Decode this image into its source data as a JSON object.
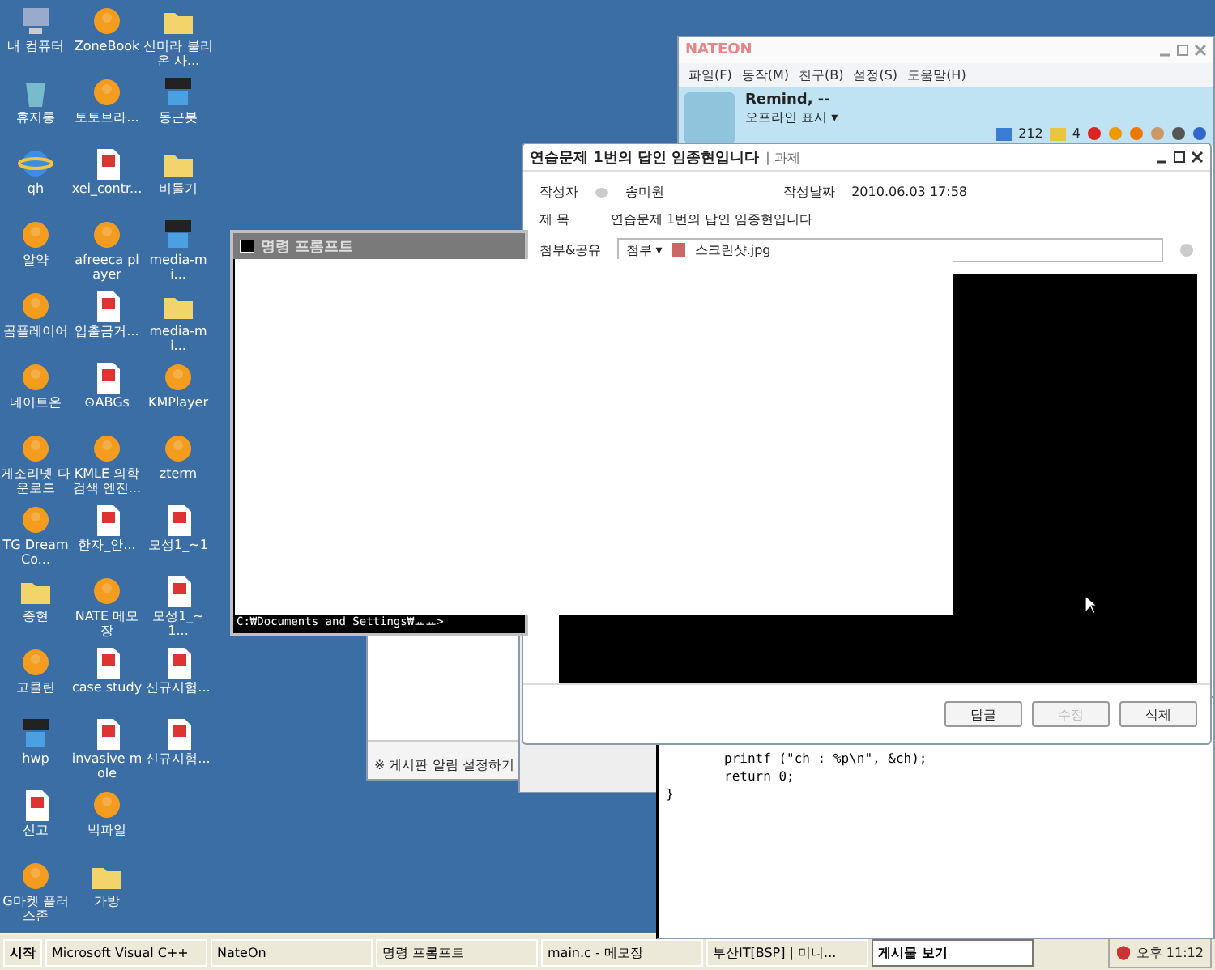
{
  "desktop_icons": [
    {
      "label": "내 컴퓨터",
      "kind": "computer"
    },
    {
      "label": "휴지통",
      "kind": "trash"
    },
    {
      "label": "qh",
      "kind": "browser"
    },
    {
      "label": "알약",
      "kind": "app"
    },
    {
      "label": "곰플레이어",
      "kind": "app"
    },
    {
      "label": "네이트온",
      "kind": "app"
    },
    {
      "label": "게소리넷 다운로드",
      "kind": "app"
    },
    {
      "label": "TG DreamCo...",
      "kind": "app"
    },
    {
      "label": "종현",
      "kind": "folder"
    },
    {
      "label": "고클린",
      "kind": "app"
    },
    {
      "label": "hwp",
      "kind": "zip"
    },
    {
      "label": "신고",
      "kind": "document"
    },
    {
      "label": "G마켓 플러스존",
      "kind": "app"
    },
    {
      "label": "ZoneBook",
      "kind": "app"
    },
    {
      "label": "토토브라...",
      "kind": "app"
    },
    {
      "label": "xei_contr...",
      "kind": "document"
    },
    {
      "label": "afreeca player",
      "kind": "app"
    },
    {
      "label": "입출금거...",
      "kind": "document"
    },
    {
      "label": "⊙ABGs",
      "kind": "document"
    },
    {
      "label": "KMLE 의학 검색 엔진...",
      "kind": "app"
    },
    {
      "label": "한자_안...",
      "kind": "document"
    },
    {
      "label": "NATE 메모장",
      "kind": "app"
    },
    {
      "label": "case study",
      "kind": "document"
    },
    {
      "label": "invasive mole",
      "kind": "document"
    },
    {
      "label": "빅파일",
      "kind": "app"
    },
    {
      "label": "가방",
      "kind": "folder"
    },
    {
      "label": "신미라 불리온 사...",
      "kind": "folder"
    },
    {
      "label": "동근봇",
      "kind": "zip"
    },
    {
      "label": "비둘기",
      "kind": "folder"
    },
    {
      "label": "media-mi...",
      "kind": "zip"
    },
    {
      "label": "media-mi...",
      "kind": "folder"
    },
    {
      "label": "KMPlayer",
      "kind": "app"
    },
    {
      "label": "zterm",
      "kind": "app"
    },
    {
      "label": "모성1_~1",
      "kind": "document"
    },
    {
      "label": "모성1_~1...",
      "kind": "document"
    },
    {
      "label": "신규시험...",
      "kind": "document"
    },
    {
      "label": "신규시험...",
      "kind": "document"
    }
  ],
  "nateon": {
    "title": "NATEON",
    "menu": [
      "파일(F)",
      "동작(M)",
      "친구(B)",
      "설정(S)",
      "도움말(H)"
    ],
    "name": "Remind, --",
    "status": "오프라인 표시 ▾",
    "mail_count": "212",
    "message_count": "4"
  },
  "board_window": {
    "footer": "※ 게시판 알림 설정하기"
  },
  "notepad": {
    "lines": [
      "printf (\"ch : %p\\n\", &ch);",
      "return 0;",
      "}"
    ]
  },
  "command_prompt": {
    "title": "명령 프롬프트",
    "prompt": "C:₩Documents and Settings₩ㅛㅛ>"
  },
  "post_window": {
    "title": "연습문제 1번의 답인 임종현입니다",
    "category": "| 과제",
    "author_label": "작성자",
    "author": "송미원",
    "date_label": "작성날짜",
    "date": "2010.06.03 17:58",
    "subject_label": "제  목",
    "subject": "연습문제 1번의 답인 임종현입니다",
    "attach_label": "첨부&공유",
    "attach_menu": "첨부 ▾",
    "attachment": "스크린샷.jpg",
    "buttons": [
      {
        "label": "답글",
        "disabled": false
      },
      {
        "label": "수정",
        "disabled": true
      },
      {
        "label": "삭제",
        "disabled": false
      }
    ]
  },
  "taskbar": {
    "start": "시작",
    "tasks": [
      {
        "label": "Microsoft Visual C++",
        "selected": false
      },
      {
        "label": "NateOn",
        "selected": false
      },
      {
        "label": "명령 프롬프트",
        "selected": false
      },
      {
        "label": "main.c - 메모장",
        "selected": false
      },
      {
        "label": "부산IT[BSP] | 미니...",
        "selected": false
      },
      {
        "label": "게시물 보기",
        "selected": true
      }
    ],
    "clock": "오후 11:12"
  }
}
